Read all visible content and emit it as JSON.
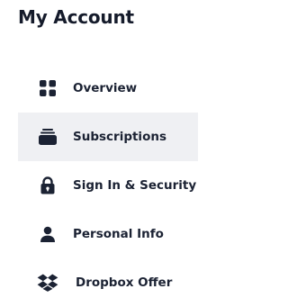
{
  "header": {
    "title": "My Account"
  },
  "nav": {
    "active": "Subscriptions",
    "items": [
      {
        "label": "Overview",
        "icon": "grid-icon"
      },
      {
        "label": "Subscriptions",
        "icon": "subscriptions-icon"
      },
      {
        "label": "Sign In & Security",
        "icon": "lock-icon"
      },
      {
        "label": "Personal Info",
        "icon": "person-icon"
      },
      {
        "label": "Dropbox Offer",
        "icon": "dropbox-icon"
      }
    ]
  },
  "colors": {
    "text": "#1b2233",
    "active_background": "#eff0f3",
    "page_background": "#ffffff"
  }
}
